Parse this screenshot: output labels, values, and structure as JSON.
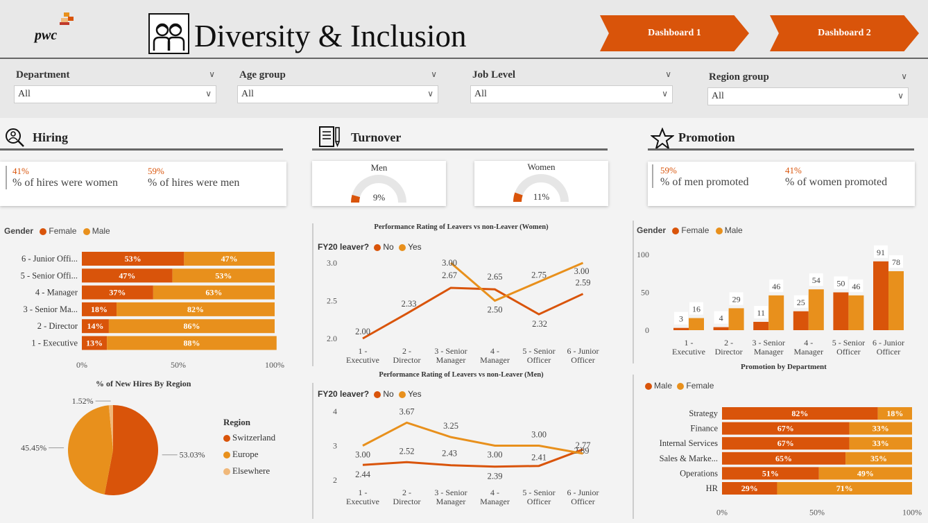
{
  "colors": {
    "orange_dark": "#d9540a",
    "orange_light": "#e8901c",
    "orange_pale": "#f0b87a",
    "button": "#d9540a"
  },
  "header": {
    "logo_text": "pwc",
    "title": "Diversity & Inclusion",
    "dash1": "Dashboard 1",
    "dash2": "Dashboard 2"
  },
  "filters": [
    {
      "label": "Department",
      "value": "All"
    },
    {
      "label": "Age group",
      "value": "All"
    },
    {
      "label": "Job Level",
      "value": "All"
    },
    {
      "label": "Region group",
      "value": "All"
    }
  ],
  "hiring": {
    "title": "Hiring",
    "kpi_women_pct": "41%",
    "kpi_women_label": "% of hires were women",
    "kpi_men_pct": "59%",
    "kpi_men_label": "% of hires were men",
    "legend_title": "Gender",
    "legend_female": "Female",
    "legend_male": "Male",
    "region_title": "% of New Hires By Region",
    "region_legend_title": "Region"
  },
  "turnover": {
    "title": "Turnover",
    "men_label": "Men",
    "men_value": "9%",
    "women_label": "Women",
    "women_value": "11%"
  },
  "promotion": {
    "title": "Promotion",
    "kpi_men_pct": "59%",
    "kpi_men_label": "% of men promoted",
    "kpi_women_pct": "41%",
    "kpi_women_label": "% of women promoted",
    "legend_title": "Gender",
    "legend_female": "Female",
    "legend_male": "Male",
    "dept_caption": "Promotion by Department",
    "dept_legend_male": "Male",
    "dept_legend_female": "Female"
  },
  "chart_data": [
    {
      "id": "hires_by_level",
      "type": "bar",
      "orientation": "horizontal-stacked-100",
      "categories": [
        "6 - Junior Offi...",
        "5 - Senior Offi...",
        "4 - Manager",
        "3 - Senior Ma...",
        "2 - Director",
        "1 - Executive"
      ],
      "series": [
        {
          "name": "Female",
          "values": [
            53,
            47,
            37,
            18,
            14,
            13
          ],
          "labels": [
            "53%",
            "47%",
            "37%",
            "18%",
            "14%",
            "13%"
          ]
        },
        {
          "name": "Male",
          "values": [
            47,
            53,
            63,
            82,
            86,
            88
          ],
          "labels": [
            "47%",
            "53%",
            "63%",
            "82%",
            "86%",
            "88%"
          ]
        }
      ],
      "xticks": [
        "0%",
        "50%",
        "100%"
      ],
      "xlim": [
        0,
        100
      ]
    },
    {
      "id": "hires_by_region",
      "type": "pie",
      "title": "% of New Hires By Region",
      "categories": [
        "Switzerland",
        "Europe",
        "Elsewhere"
      ],
      "values": [
        53.03,
        45.45,
        1.52
      ],
      "labels": [
        "53.03%",
        "45.45%",
        "1.52%"
      ]
    },
    {
      "id": "leavers_women",
      "type": "line",
      "title": "Performance Rating of Leavers vs non-Leaver (Women)",
      "legend_title": "FY20 leaver?",
      "x": [
        "1 -|Executive",
        "2 -|Director",
        "3 - Senior|Manager",
        "4 -|Manager",
        "5 - Senior|Officer",
        "6 - Junior|Officer"
      ],
      "series": [
        {
          "name": "No",
          "values": [
            2.0,
            2.33,
            2.67,
            2.65,
            2.32,
            2.59
          ],
          "labels": [
            "2.00",
            "2.33",
            "2.67",
            "2.65",
            "2.32",
            "2.59"
          ]
        },
        {
          "name": "Yes",
          "values": [
            null,
            null,
            3.0,
            2.5,
            2.75,
            3.0
          ],
          "labels": [
            "",
            "",
            "3.00",
            "2.50",
            "2.75",
            "3.00"
          ]
        }
      ],
      "yticks": [
        "2.0",
        "2.5",
        "3.0"
      ],
      "ylim": [
        2.0,
        3.0
      ]
    },
    {
      "id": "leavers_men",
      "type": "line",
      "title": "Performance Rating of Leavers vs non-Leaver (Men)",
      "legend_title": "FY20 leaver?",
      "x": [
        "1 -|Executive",
        "2 -|Director",
        "3 - Senior|Manager",
        "4 -|Manager",
        "5 - Senior|Officer",
        "6 - Junior|Officer"
      ],
      "series": [
        {
          "name": "No",
          "values": [
            2.44,
            2.52,
            2.43,
            2.39,
            2.41,
            2.89
          ],
          "labels": [
            "2.44",
            "2.52",
            "2.43",
            "2.39",
            "2.41",
            "2.89"
          ]
        },
        {
          "name": "Yes",
          "values": [
            3.0,
            3.67,
            3.25,
            3.0,
            3.0,
            2.77
          ],
          "labels": [
            "3.00",
            "3.67",
            "3.25",
            "3.00",
            "3.00",
            "2.77"
          ]
        }
      ],
      "yticks": [
        "2",
        "3",
        "4"
      ],
      "ylim": [
        2,
        4
      ]
    },
    {
      "id": "promotion_by_level",
      "type": "bar",
      "orientation": "vertical-grouped",
      "categories": [
        "1 -|Executive",
        "2 -|Director",
        "3 - Senior|Manager",
        "4 -|Manager",
        "5 - Senior|Officer",
        "6 - Junior|Officer"
      ],
      "series": [
        {
          "name": "Female",
          "values": [
            3,
            4,
            11,
            25,
            50,
            91
          ]
        },
        {
          "name": "Male",
          "values": [
            16,
            29,
            46,
            54,
            46,
            78
          ]
        }
      ],
      "yticks": [
        "0",
        "50",
        "100"
      ],
      "ylim": [
        0,
        100
      ]
    },
    {
      "id": "promotion_by_department",
      "type": "bar",
      "orientation": "horizontal-stacked-100",
      "title": "Promotion by Department",
      "categories": [
        "Strategy",
        "Finance",
        "Internal Services",
        "Sales & Marke...",
        "Operations",
        "HR"
      ],
      "series": [
        {
          "name": "Male",
          "values": [
            82,
            67,
            67,
            65,
            51,
            29
          ],
          "labels": [
            "82%",
            "67%",
            "67%",
            "65%",
            "51%",
            "29%"
          ]
        },
        {
          "name": "Female",
          "values": [
            18,
            33,
            33,
            35,
            49,
            71
          ],
          "labels": [
            "18%",
            "33%",
            "33%",
            "35%",
            "49%",
            "71%"
          ]
        }
      ],
      "xticks": [
        "0%",
        "50%",
        "100%"
      ],
      "xlim": [
        0,
        100
      ]
    }
  ]
}
